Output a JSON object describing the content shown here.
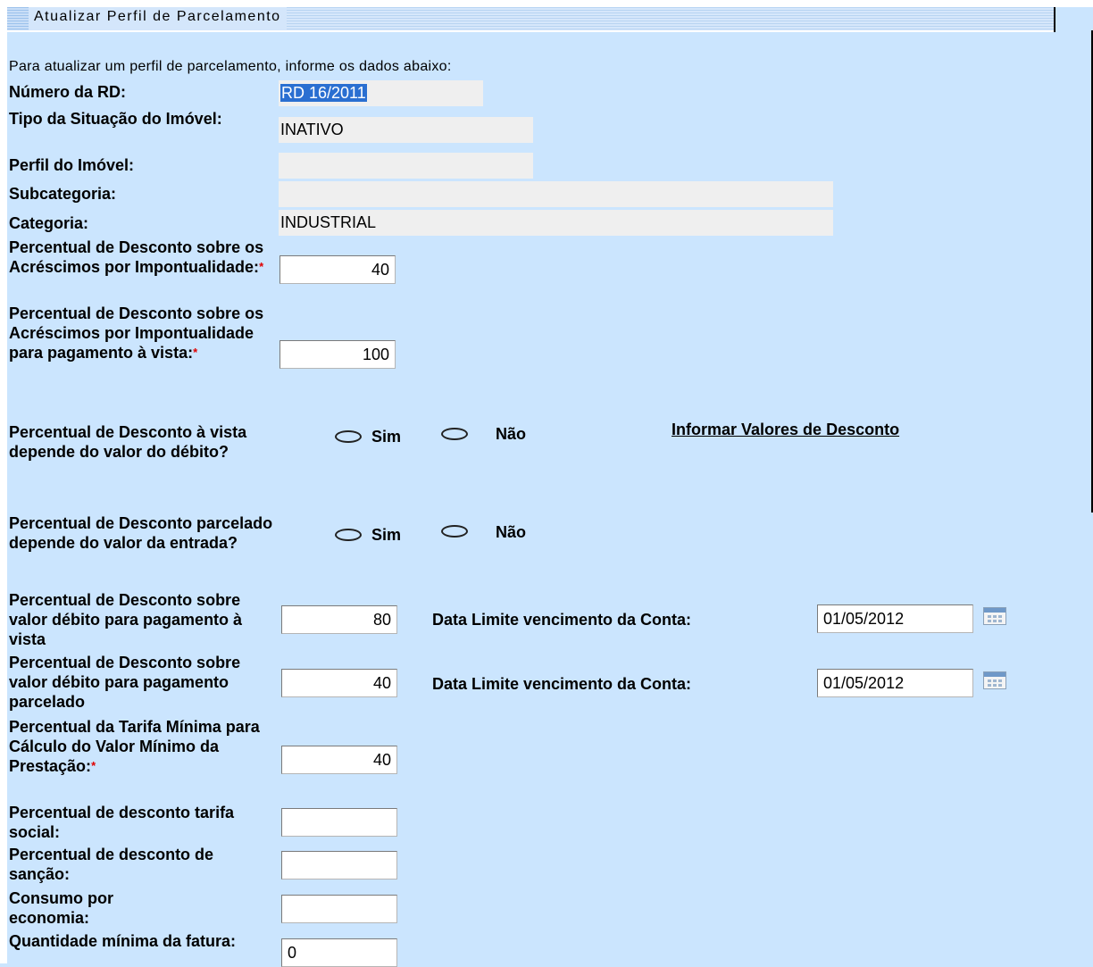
{
  "header": {
    "title": "Atualizar Perfil de Parcelamento"
  },
  "intro": "Para atualizar um perfil de parcelamento, informe os dados abaixo:",
  "fields": {
    "numero_rd": {
      "label": "Número da RD:",
      "value": "RD 16/2011"
    },
    "tipo_situacao": {
      "label": "Tipo da Situação do Imóvel:",
      "value": "INATIVO"
    },
    "perfil_imovel": {
      "label": "Perfil do Imóvel:",
      "value": ""
    },
    "subcategoria": {
      "label": "Subcategoria:",
      "value": ""
    },
    "categoria": {
      "label": "Categoria:",
      "value": "INDUSTRIAL"
    },
    "desc_acrescimos": {
      "label": "Percentual de Desconto sobre os Acréscimos por Impontualidade:",
      "value": "40"
    },
    "desc_acrescimos_vista": {
      "label": "Percentual de Desconto sobre os Acréscimos por Impontualidade para pagamento à vista:",
      "value": "100"
    },
    "desc_vista_depende": {
      "label": "Percentual de Desconto à vista depende do valor do débito?",
      "opt_sim": "Sim",
      "opt_nao": "Não"
    },
    "desc_parcelado_depende": {
      "label": "Percentual de Desconto parcelado depende do valor da entrada?",
      "opt_sim": "Sim",
      "opt_nao": "Não"
    },
    "desc_debito_vista": {
      "label": "Percentual de Desconto sobre valor débito para pagamento à vista",
      "value": "80",
      "date_label": "Data Limite vencimento da Conta:",
      "date_value": "01/05/2012"
    },
    "desc_debito_parcelado": {
      "label": "Percentual de Desconto sobre valor débito para pagamento parcelado",
      "value": "40",
      "date_label": "Data Limite vencimento da Conta:",
      "date_value": "01/05/2012"
    },
    "tarifa_minima": {
      "label": "Percentual da Tarifa Mínima para Cálculo do Valor Mínimo da Prestação:",
      "value": "40"
    },
    "tarifa_social": {
      "label": "Percentual de desconto tarifa social:",
      "value": ""
    },
    "sancao": {
      "label": "Percentual de desconto de sanção:",
      "value": ""
    },
    "consumo_economia": {
      "label": "Consumo por economia:",
      "value": ""
    },
    "qtd_minima_fatura": {
      "label": "Quantidade mínima da fatura:",
      "value": "0"
    }
  },
  "link_informar": "Informar Valores de Desconto",
  "required_mark": "*"
}
